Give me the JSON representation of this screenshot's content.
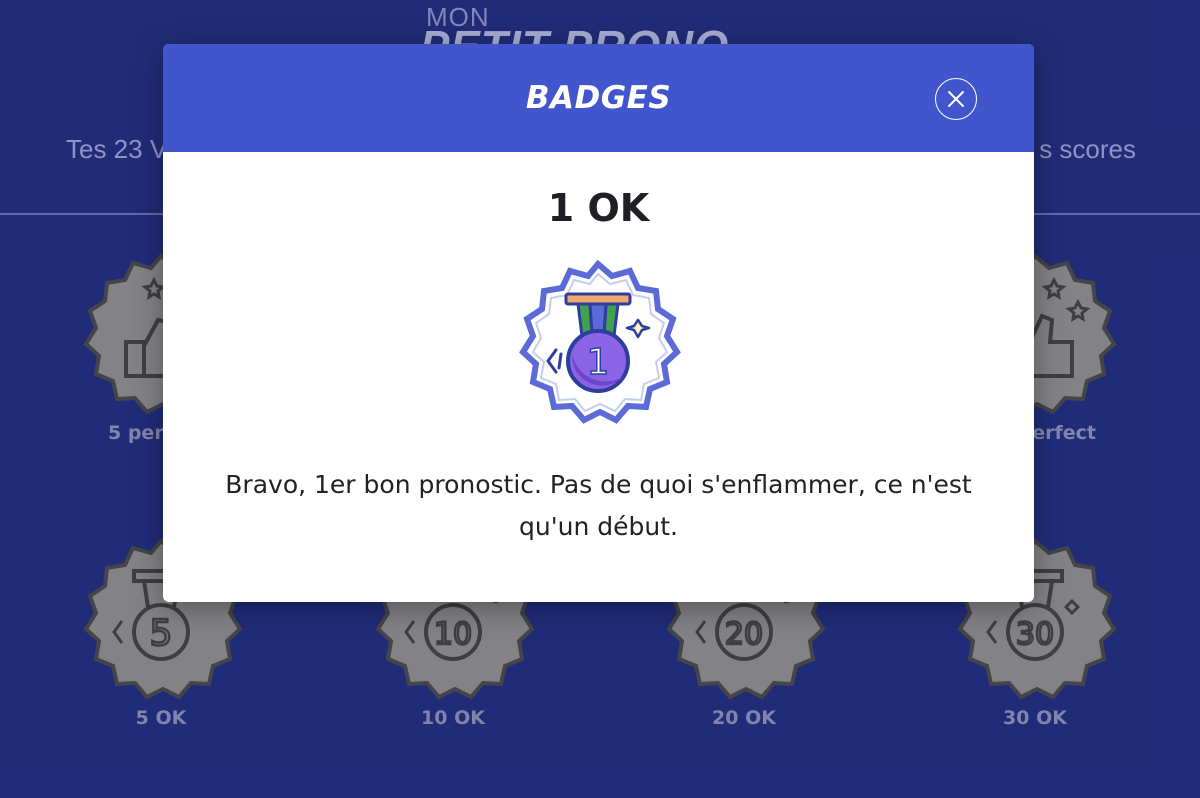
{
  "background": {
    "logo_top": "MON",
    "logo_bottom": "PETIT PRONO",
    "subtitle_left": "Tes 23 V",
    "subtitle_right": "s scores",
    "badges": [
      {
        "label": "5 per",
        "icon": "thumbs-up-badge-icon"
      },
      {
        "label": "erfect",
        "icon": "thumbs-up-stars-badge-icon"
      },
      {
        "label": "5 OK",
        "number": "5",
        "icon": "medal-5-badge-icon"
      },
      {
        "label": "10 OK",
        "number": "10",
        "icon": "medal-10-badge-icon"
      },
      {
        "label": "20 OK",
        "number": "20",
        "icon": "medal-20-badge-icon"
      },
      {
        "label": "30 OK",
        "number": "30",
        "icon": "medal-30-badge-icon"
      }
    ]
  },
  "modal": {
    "title": "BADGES",
    "badge_name": "1 OK",
    "badge_number": "1",
    "description": "Bravo, 1er bon pronostic. Pas de quoi s'enflammer, ce n'est qu'un début.",
    "close_icon": "close-icon"
  },
  "colors": {
    "page_background": "#232f7e",
    "header": "#4156cc",
    "badge_ring": "#5b6ad6",
    "medal": "#8a63e6",
    "ribbon_green": "#3fa34d",
    "inactive_badge": "#8e8e8e"
  }
}
